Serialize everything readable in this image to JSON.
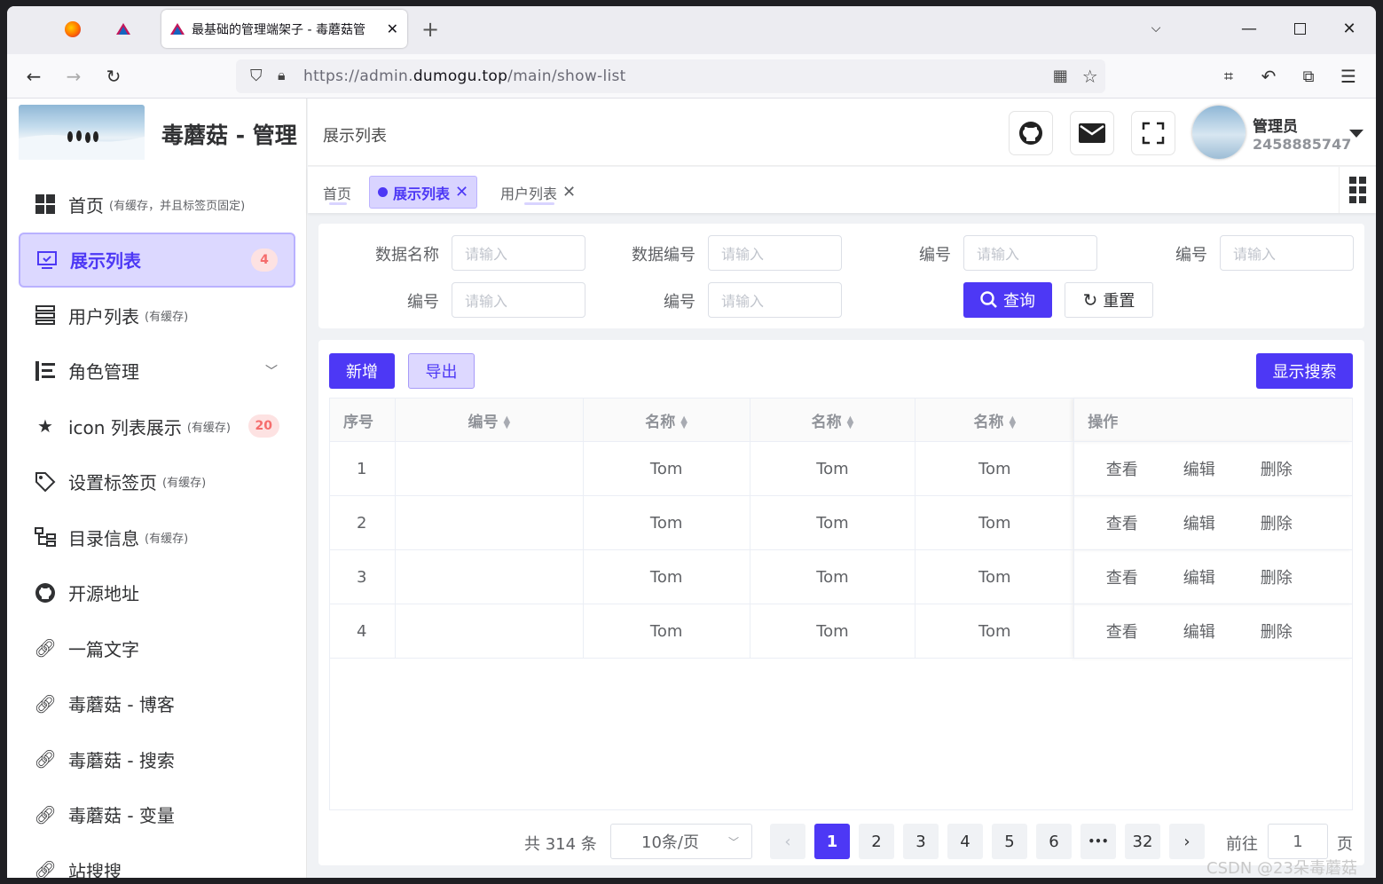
{
  "browser": {
    "tab_active_title": "最基础的管理端架子 - 毒蘑菇管",
    "new_tab": "+",
    "url_prefix": "https://admin.",
    "url_domain": "dumogu.top",
    "url_path": "/main/show-list"
  },
  "sidebar": {
    "title": "毒蘑菇 - 管理",
    "items": [
      {
        "icon": "grid-icon",
        "label": "首页",
        "note": "(有缓存，并且标签页固定)"
      },
      {
        "icon": "monitor-icon",
        "label": "展示列表",
        "badge": "4",
        "active": true
      },
      {
        "icon": "list-icon",
        "label": "用户列表",
        "note": "(有缓存)"
      },
      {
        "icon": "role-icon",
        "label": "角色管理"
      },
      {
        "icon": "star-icon",
        "label": "icon 列表展示",
        "note": "(有缓存)",
        "badge": "20"
      },
      {
        "icon": "tag-icon",
        "label": "设置标签页",
        "note": "(有缓存)"
      },
      {
        "icon": "tree-icon",
        "label": "目录信息",
        "note": "(有缓存)"
      },
      {
        "icon": "github-icon",
        "label": "开源地址"
      },
      {
        "icon": "link-icon",
        "label": "一篇文字"
      },
      {
        "icon": "link-icon",
        "label": "毒蘑菇 - 博客"
      },
      {
        "icon": "link-icon",
        "label": "毒蘑菇 - 搜索"
      },
      {
        "icon": "link-icon",
        "label": "毒蘑菇 - 变量"
      },
      {
        "icon": "link-icon",
        "label": "站搜搜"
      }
    ]
  },
  "header": {
    "breadcrumb": "展示列表",
    "user_name": "管理员",
    "user_id": "2458885747"
  },
  "tags": [
    {
      "label": "首页"
    },
    {
      "label": "展示列表",
      "active": true
    },
    {
      "label": "用户列表"
    }
  ],
  "search": {
    "fields": [
      {
        "label": "数据名称",
        "placeholder": "请输入"
      },
      {
        "label": "数据编号",
        "placeholder": "请输入"
      },
      {
        "label": "编号",
        "placeholder": "请输入"
      },
      {
        "label": "编号",
        "placeholder": "请输入"
      },
      {
        "label": "编号",
        "placeholder": "请输入"
      },
      {
        "label": "编号",
        "placeholder": "请输入"
      }
    ],
    "query_label": "查询",
    "reset_label": "重置"
  },
  "actions": {
    "add_label": "新增",
    "export_label": "导出",
    "toggle_search_label": "显示搜索"
  },
  "table": {
    "headers": [
      "序号",
      "编号",
      "名称",
      "名称",
      "名称",
      "操作"
    ],
    "rows": [
      {
        "index": "1",
        "code": "",
        "name1": "Tom",
        "name2": "Tom",
        "name3": "Tom"
      },
      {
        "index": "2",
        "code": "",
        "name1": "Tom",
        "name2": "Tom",
        "name3": "Tom"
      },
      {
        "index": "3",
        "code": "",
        "name1": "Tom",
        "name2": "Tom",
        "name3": "Tom"
      },
      {
        "index": "4",
        "code": "",
        "name1": "Tom",
        "name2": "Tom",
        "name3": "Tom"
      }
    ],
    "ops": [
      "查看",
      "编辑",
      "删除"
    ]
  },
  "pagination": {
    "total": "共 314 条",
    "page_size": "10条/页",
    "pages": [
      "1",
      "2",
      "3",
      "4",
      "5",
      "6",
      "•••",
      "32"
    ],
    "current": "1",
    "goto_prefix": "前往",
    "goto_value": "1",
    "goto_suffix": "页"
  },
  "watermark": "CSDN @23朵毒蘑菇"
}
